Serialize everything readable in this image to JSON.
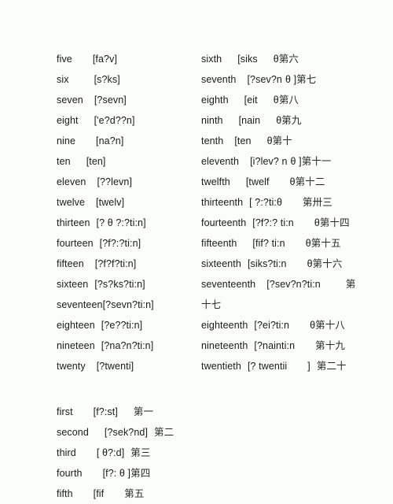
{
  "document": {
    "background_color": "#fbfdfa",
    "text_color": "#1a1a1a",
    "title": "English numbers vocabulary list — cardinals and ordinals with phonetics and Chinese glosses"
  },
  "cardinals": [
    {
      "word": "five",
      "phonetic": "[fa?v]"
    },
    {
      "word": "six",
      "phonetic": "[s?ks]"
    },
    {
      "word": "seven",
      "phonetic": "[?sevn]"
    },
    {
      "word": "eight",
      "phonetic": "['e?d??n]"
    },
    {
      "word": "nine",
      "phonetic": "[na?n]"
    },
    {
      "word": "ten",
      "phonetic": "[ten]"
    },
    {
      "word": "eleven",
      "phonetic": "[??levn]"
    },
    {
      "word": "twelve",
      "phonetic": "[twelv]"
    },
    {
      "word": "thirteen",
      "phonetic": "[?  θ ?:?ti:n]"
    },
    {
      "word": "fourteen",
      "phonetic": "[?f?:?ti:n]"
    },
    {
      "word": "fifteen",
      "phonetic": "[?f?f?ti:n]"
    },
    {
      "word": "sixteen",
      "phonetic": "[?s?ks?ti:n]"
    },
    {
      "word": "seventeen",
      "phonetic": "[?sevn?ti:n]"
    },
    {
      "word": "eighteen",
      "phonetic": "[?e??ti:n]"
    },
    {
      "word": "nineteen",
      "phonetic": "[?na?n?ti:n]"
    },
    {
      "word": "twenty",
      "phonetic": "[?twenti]"
    }
  ],
  "ordinals_right": [
    {
      "word": "sixth",
      "phonetic": "[siks",
      "mark": "θ",
      "chinese": "第六"
    },
    {
      "word": "seventh",
      "phonetic": "[?sev?n",
      "mark": "θ ]",
      "chinese": "第七"
    },
    {
      "word": "eighth",
      "phonetic": "[eit",
      "mark": "θ",
      "chinese": "第八"
    },
    {
      "word": "ninth",
      "phonetic": "[nain",
      "mark": "θ",
      "chinese": "第九"
    },
    {
      "word": "tenth",
      "phonetic": "[ten",
      "mark": "θ",
      "chinese": "第十"
    },
    {
      "word": "eleventh",
      "phonetic": "[i?lev? n",
      "mark": "θ ]",
      "chinese": "第十一"
    },
    {
      "word": "twelfth",
      "phonetic": "[twelf",
      "mark": "θ",
      "chinese": "第十二"
    },
    {
      "word": "thirteenth",
      "phonetic": "[   ?:?ti:θ",
      "mark": "",
      "chinese": "第卅三"
    },
    {
      "word": "fourteenth",
      "phonetic": "[?f?:? ti:n",
      "mark": "θ",
      "chinese": "第十四"
    },
    {
      "word": "fifteenth",
      "phonetic": "[fif? ti:n",
      "mark": "θ",
      "chinese": "第十五"
    },
    {
      "word": "sixteenth",
      "phonetic": "[siks?ti:n",
      "mark": "θ",
      "chinese": "第十六"
    },
    {
      "word": "seventeenth",
      "phonetic": "[?sev?n?ti:n",
      "mark": "",
      "chinese": "第",
      "chinese_cont": "十七"
    },
    {
      "word": "eighteenth",
      "phonetic": "[?ei?ti:n",
      "mark": "θ",
      "chinese": "第十八"
    },
    {
      "word": "nineteenth",
      "phonetic": "[?nainti:n",
      "mark": "",
      "chinese": "第十九"
    },
    {
      "word": "twentieth",
      "phonetic": "[? twentii",
      "mark": "]",
      "chinese": "第二十"
    }
  ],
  "ordinals_bottom": [
    {
      "word": "first",
      "phonetic": "[f?:st]",
      "mark": "",
      "chinese": "第一"
    },
    {
      "word": "second",
      "phonetic": "[?sek?nd]",
      "mark": "",
      "chinese": "第二"
    },
    {
      "word": "third",
      "phonetic": "[ θ?:d]",
      "mark": "",
      "chinese": "第三"
    },
    {
      "word": "fourth",
      "phonetic": "[f?: ",
      "mark": "θ ]",
      "chinese": "第四"
    },
    {
      "word": "fifth",
      "phonetic": "[fif",
      "mark": "",
      "chinese": "第五"
    }
  ]
}
